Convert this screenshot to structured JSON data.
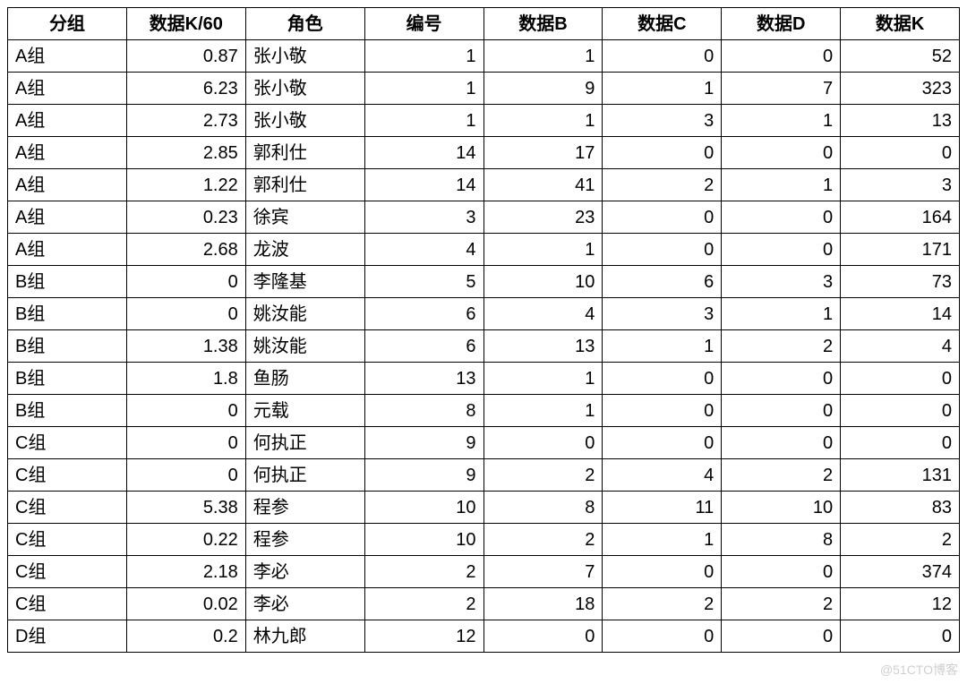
{
  "chart_data": {
    "type": "table",
    "headers": [
      "分组",
      "数据K/60",
      "角色",
      "编号",
      "数据B",
      "数据C",
      "数据D",
      "数据K"
    ],
    "rows": [
      {
        "group": "A组",
        "k60": "0.87",
        "role": "张小敬",
        "num": "1",
        "b": "1",
        "c": "0",
        "d": "0",
        "k": "52"
      },
      {
        "group": "A组",
        "k60": "6.23",
        "role": "张小敬",
        "num": "1",
        "b": "9",
        "c": "1",
        "d": "7",
        "k": "323"
      },
      {
        "group": "A组",
        "k60": "2.73",
        "role": "张小敬",
        "num": "1",
        "b": "1",
        "c": "3",
        "d": "1",
        "k": "13"
      },
      {
        "group": "A组",
        "k60": "2.85",
        "role": "郭利仕",
        "num": "14",
        "b": "17",
        "c": "0",
        "d": "0",
        "k": "0"
      },
      {
        "group": "A组",
        "k60": "1.22",
        "role": "郭利仕",
        "num": "14",
        "b": "41",
        "c": "2",
        "d": "1",
        "k": "3"
      },
      {
        "group": "A组",
        "k60": "0.23",
        "role": "徐宾",
        "num": "3",
        "b": "23",
        "c": "0",
        "d": "0",
        "k": "164"
      },
      {
        "group": "A组",
        "k60": "2.68",
        "role": "龙波",
        "num": "4",
        "b": "1",
        "c": "0",
        "d": "0",
        "k": "171"
      },
      {
        "group": "B组",
        "k60": "0",
        "role": "李隆基",
        "num": "5",
        "b": "10",
        "c": "6",
        "d": "3",
        "k": "73"
      },
      {
        "group": "B组",
        "k60": "0",
        "role": "姚汝能",
        "num": "6",
        "b": "4",
        "c": "3",
        "d": "1",
        "k": "14"
      },
      {
        "group": "B组",
        "k60": "1.38",
        "role": "姚汝能",
        "num": "6",
        "b": "13",
        "c": "1",
        "d": "2",
        "k": "4"
      },
      {
        "group": "B组",
        "k60": "1.8",
        "role": "鱼肠",
        "num": "13",
        "b": "1",
        "c": "0",
        "d": "0",
        "k": "0"
      },
      {
        "group": "B组",
        "k60": "0",
        "role": "元载",
        "num": "8",
        "b": "1",
        "c": "0",
        "d": "0",
        "k": "0"
      },
      {
        "group": "C组",
        "k60": "0",
        "role": "何执正",
        "num": "9",
        "b": "0",
        "c": "0",
        "d": "0",
        "k": "0"
      },
      {
        "group": "C组",
        "k60": "0",
        "role": "何执正",
        "num": "9",
        "b": "2",
        "c": "4",
        "d": "2",
        "k": "131"
      },
      {
        "group": "C组",
        "k60": "5.38",
        "role": "程参",
        "num": "10",
        "b": "8",
        "c": "11",
        "d": "10",
        "k": "83"
      },
      {
        "group": "C组",
        "k60": "0.22",
        "role": "程参",
        "num": "10",
        "b": "2",
        "c": "1",
        "d": "8",
        "k": "2"
      },
      {
        "group": "C组",
        "k60": "2.18",
        "role": "李必",
        "num": "2",
        "b": "7",
        "c": "0",
        "d": "0",
        "k": "374"
      },
      {
        "group": "C组",
        "k60": "0.02",
        "role": "李必",
        "num": "2",
        "b": "18",
        "c": "2",
        "d": "2",
        "k": "12"
      },
      {
        "group": "D组",
        "k60": "0.2",
        "role": "林九郎",
        "num": "12",
        "b": "0",
        "c": "0",
        "d": "0",
        "k": "0"
      }
    ]
  },
  "watermark": "@51CTO博客"
}
